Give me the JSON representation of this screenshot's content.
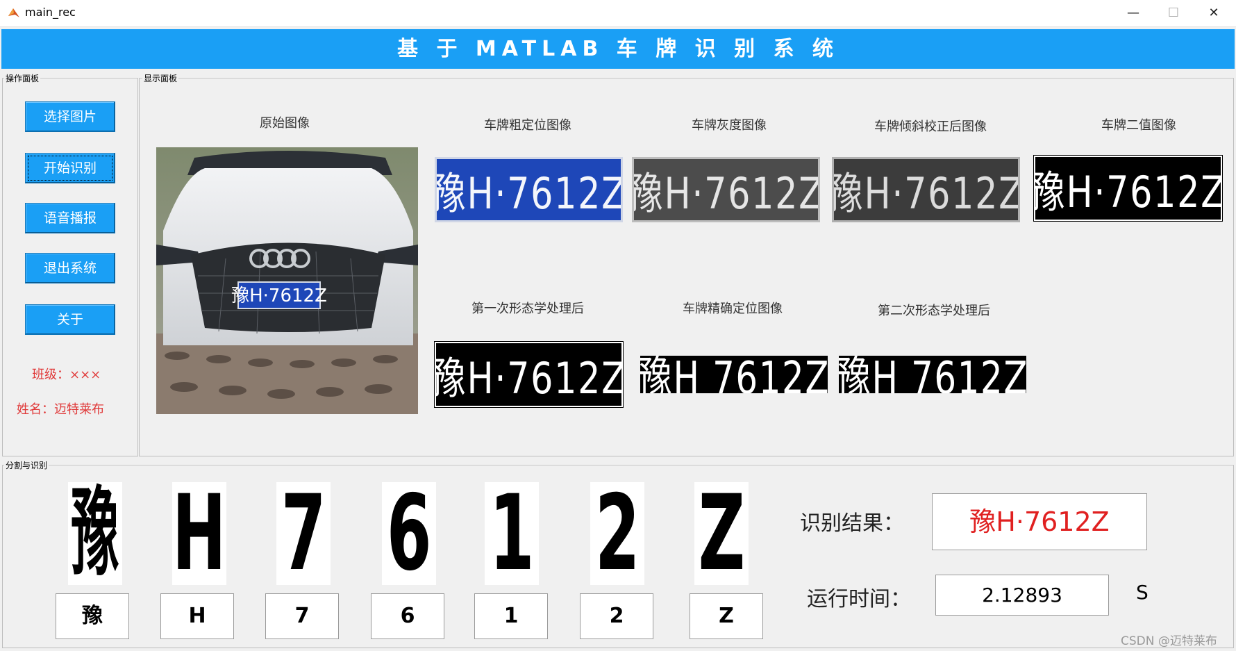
{
  "window": {
    "title": "main_rec",
    "minimize": "—",
    "maximize": "☐",
    "close": "✕"
  },
  "banner": {
    "title": "基 于 MATLAB 车 牌 识 别 系 统"
  },
  "ops_panel": {
    "title": "操作面板",
    "buttons": [
      "选择图片",
      "开始识别",
      "语音播报",
      "退出系统",
      "关于"
    ],
    "class_label": "班级：×××",
    "name_label": "姓名：迈特莱布"
  },
  "display_panel": {
    "title": "显示面板",
    "captions": {
      "original": "原始图像",
      "coarse": "车牌粗定位图像",
      "gray": "车牌灰度图像",
      "tilt": "车牌倾斜校正后图像",
      "binary": "车牌二值图像",
      "morph1": "第一次形态学处理后",
      "precise": "车牌精确定位图像",
      "morph2": "第二次形态学处理后"
    },
    "plate_text": "豫H·7612Z",
    "plate_text_spaced": "豫H 7612Z"
  },
  "seg_panel": {
    "title": "分割与识别",
    "chars": [
      "豫",
      "H",
      "7",
      "6",
      "1",
      "2",
      "Z"
    ],
    "result_label": "识别结果：",
    "result_value": "豫H·7612Z",
    "time_label": "运行时间：",
    "time_value": "2.12893",
    "time_unit": "S"
  },
  "watermark": "CSDN @迈特莱布",
  "colors": {
    "banner": "#1a9ff5",
    "button": "#1a9ff5",
    "plate_blue": "#1e47b8",
    "result_text": "#e02020",
    "labels_red": "#e03a3a"
  },
  "icons": {
    "app": "matlab-icon",
    "minimize": "minimize-icon",
    "maximize": "maximize-icon",
    "close": "close-icon"
  }
}
